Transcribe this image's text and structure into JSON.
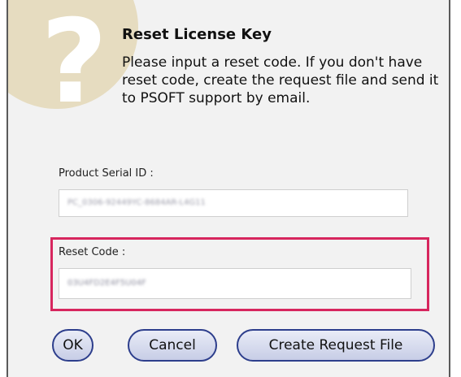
{
  "dialog": {
    "icon": "question-mark-icon",
    "title": "Reset License Key",
    "message": "Please input a reset code. If you don't have reset code, create the request file and send it to PSOFT support by email."
  },
  "serial": {
    "label": "Product Serial ID :",
    "value": "PC_0306-92449YC-8684AR-L4G11"
  },
  "reset": {
    "label": "Reset Code :",
    "value": "03U4FD2E4F5U04F",
    "highlight_color": "#d7265e"
  },
  "buttons": {
    "ok": "OK",
    "cancel": "Cancel",
    "create_request": "Create Request File"
  },
  "colors": {
    "dialog_bg": "#f2f2f2",
    "button_border": "#2d3e8c",
    "icon_circle": "#e6dcc0"
  }
}
